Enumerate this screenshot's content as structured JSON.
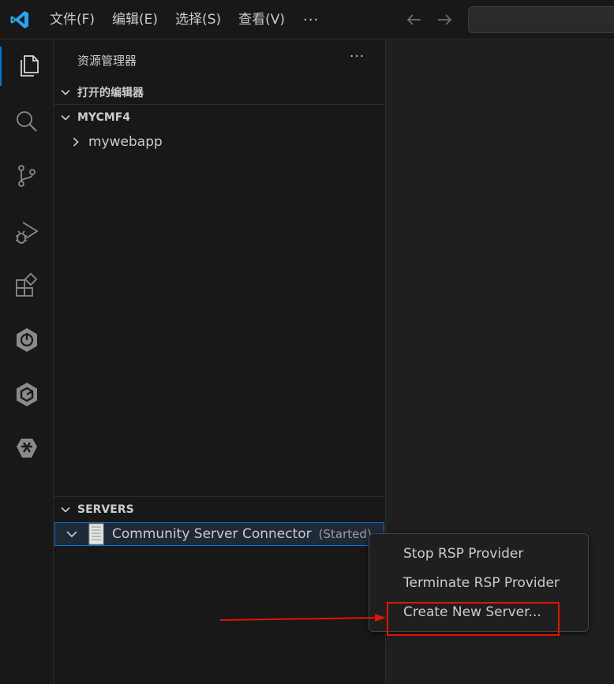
{
  "titlebar": {
    "menu": [
      "文件(F)",
      "编辑(E)",
      "选择(S)",
      "查看(V)"
    ],
    "more_glyph": "···",
    "back_icon": "arrow-left-icon",
    "forward_icon": "arrow-right-icon"
  },
  "activity_bar": {
    "items": [
      "explorer-icon",
      "search-icon",
      "source-control-icon",
      "run-debug-icon",
      "extensions-icon",
      "spring-boot-icon",
      "gitpod-icon",
      "remote-icon"
    ]
  },
  "sidebar": {
    "title": "资源管理器",
    "more_glyph": "···",
    "open_editors": "打开的编辑器",
    "workspace": "MYCMF4",
    "tree": [
      {
        "label": "mywebapp",
        "expanded": false
      }
    ],
    "servers_section": "SERVERS",
    "server": {
      "name": "Community Server Connector",
      "status": "(Started)"
    }
  },
  "context_menu": {
    "items": [
      "Stop RSP Provider",
      "Terminate RSP Provider",
      "Create New Server..."
    ]
  },
  "annotation": {
    "color": "#e51400",
    "highlighted_item": "Create New Server..."
  },
  "colors": {
    "accent": "#0078d4",
    "background": "#1f1f1f",
    "sidebar": "#181818"
  }
}
